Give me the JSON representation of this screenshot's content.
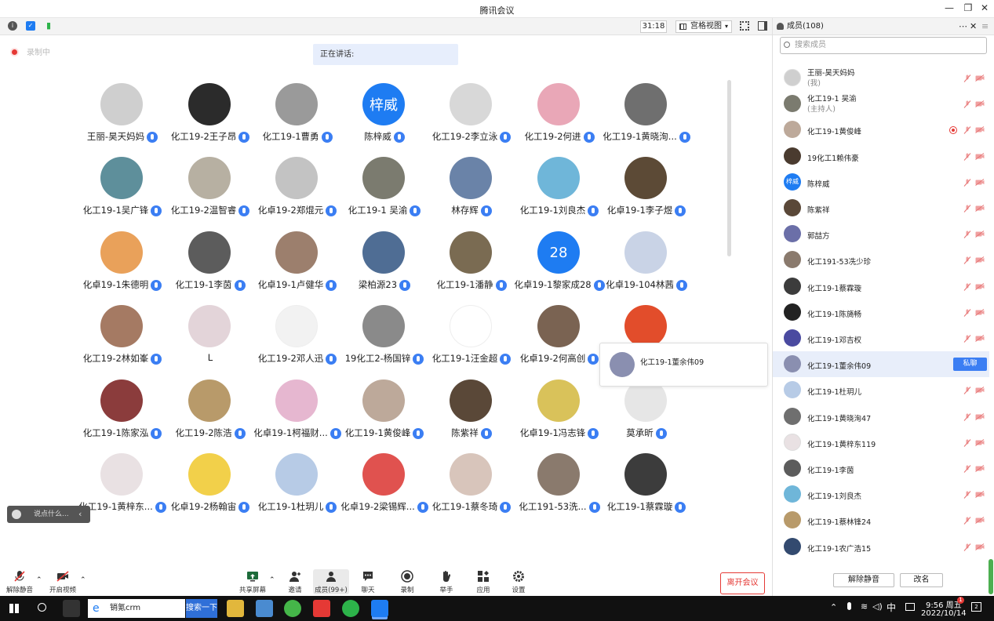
{
  "window": {
    "title": "腾讯会议"
  },
  "toolbar": {
    "timer": "31:18",
    "view_mode": "宫格视图"
  },
  "recording": {
    "label": "录制中"
  },
  "speaking": {
    "label": "正在讲话:"
  },
  "grid": [
    {
      "name": "王丽-昊天妈妈",
      "color": "#cfcfcf",
      "text": ""
    },
    {
      "name": "化工19-2王子昂",
      "color": "#2b2b2b",
      "text": ""
    },
    {
      "name": "化工19-1曹勇",
      "color": "#9a9a9a",
      "text": ""
    },
    {
      "name": "陈梓威",
      "color": "#1e7cf2",
      "text": "梓威"
    },
    {
      "name": "化工19-2李立泳",
      "color": "#d8d8d8",
      "text": ""
    },
    {
      "name": "化工19-2何进",
      "color": "#e9a7b7",
      "text": ""
    },
    {
      "name": "化工19-1黄晓洵...",
      "color": "#6f6f6f",
      "text": ""
    },
    {
      "name": "化工19-1吴广锋",
      "color": "#5e8f9b",
      "text": ""
    },
    {
      "name": "化工19-2温智睿",
      "color": "#b7b0a2",
      "text": ""
    },
    {
      "name": "化卓19-2郑焜元",
      "color": "#c3c3c3",
      "text": ""
    },
    {
      "name": "化工19-1 吴渝",
      "color": "#7b7b6f",
      "text": ""
    },
    {
      "name": "林存辉",
      "color": "#6a83a8",
      "text": ""
    },
    {
      "name": "化工19-1刘良杰",
      "color": "#6fb6d9",
      "text": ""
    },
    {
      "name": "化卓19-1李子煜",
      "color": "#5c4a36",
      "text": ""
    },
    {
      "name": "化卓19-1朱德明",
      "color": "#e9a15a",
      "text": ""
    },
    {
      "name": "化工19-1李茵",
      "color": "#5c5c5c",
      "text": ""
    },
    {
      "name": "化卓19-1卢健华",
      "color": "#9c7f6d",
      "text": ""
    },
    {
      "name": "梁柏源23",
      "color": "#4f6d94",
      "text": ""
    },
    {
      "name": "化工19-1潘静",
      "color": "#7a6b52",
      "text": ""
    },
    {
      "name": "化卓19-1黎家成28",
      "color": "#1e7cf2",
      "text": "28"
    },
    {
      "name": "化卓19-104林茜",
      "color": "#c9d3e6",
      "text": ""
    },
    {
      "name": "化工19-2林如峯",
      "color": "#a57a63",
      "text": ""
    },
    {
      "name": "L",
      "color": "#e3d4d9",
      "text": ""
    },
    {
      "name": "化工19-2邓人迅",
      "color": "#f2f2f2",
      "text": ""
    },
    {
      "name": "19化工2-杨国锌",
      "color": "#8a8a8a",
      "text": ""
    },
    {
      "name": "化工19-1汪金超",
      "color": "#ffffff",
      "text": ""
    },
    {
      "name": "化卓19-2何高创",
      "color": "#7a6352",
      "text": ""
    },
    {
      "name": "",
      "color": "#e24d2b",
      "text": ""
    },
    {
      "name": "化工19-1陈家泓",
      "color": "#8b3c3c",
      "text": ""
    },
    {
      "name": "化工19-2陈浩",
      "color": "#b89a6a",
      "text": ""
    },
    {
      "name": "化卓19-1柯福财...",
      "color": "#e6b7d0",
      "text": ""
    },
    {
      "name": "化工19-1黄俊峰",
      "color": "#bda99a",
      "text": ""
    },
    {
      "name": "陈紫祥",
      "color": "#5a4838",
      "text": ""
    },
    {
      "name": "化卓19-1冯志锋",
      "color": "#d9c25a",
      "text": ""
    },
    {
      "name": "莫承昕",
      "color": "#e6e6e6",
      "text": ""
    },
    {
      "name": "化工19-1黄梓东...",
      "color": "#e9e1e3",
      "text": ""
    },
    {
      "name": "化卓19-2杨翰宙",
      "color": "#f2d04a",
      "text": ""
    },
    {
      "name": "化工19-1杜玥儿",
      "color": "#b7cbe6",
      "text": ""
    },
    {
      "name": "化卓19-2梁锡辉...",
      "color": "#e0524f",
      "text": ""
    },
    {
      "name": "化工19-1蔡冬琦",
      "color": "#d8c5bb",
      "text": ""
    },
    {
      "name": "化工191-53洗...",
      "color": "#8a7a6d",
      "text": ""
    },
    {
      "name": "化工19-1蔡霖璇",
      "color": "#3c3c3c",
      "text": ""
    }
  ],
  "popup": {
    "name": "化工19-1董余伟09"
  },
  "chat": {
    "placeholder": "说点什么..."
  },
  "bottom": {
    "unmute": "解除静音",
    "video": "开启视频",
    "share": "共享屏幕",
    "invite": "邀请",
    "members": "成员(99+)",
    "chat": "聊天",
    "record": "录制",
    "raise": "举手",
    "apps": "应用",
    "settings": "设置",
    "leave": "离开会议"
  },
  "side": {
    "title": "成员(108)",
    "search_placeholder": "搜索成员",
    "private_chat": "私聊",
    "unmute_all": "解除静音",
    "rename": "改名",
    "members": [
      {
        "name": "王丽-昊天妈妈",
        "sub": "(我)",
        "color": "#cfcfcf",
        "text": ""
      },
      {
        "name": "化工19-1 吴渝",
        "sub": "(主持人)",
        "color": "#7b7b6f",
        "text": ""
      },
      {
        "name": "化工19-1黄俊峰",
        "sub": "",
        "color": "#bda99a",
        "text": ""
      },
      {
        "name": "19化工1赖伟豪",
        "sub": "",
        "color": "#4a3b2f",
        "text": ""
      },
      {
        "name": "陈梓威",
        "sub": "",
        "color": "#1e7cf2",
        "text": "梓威"
      },
      {
        "name": "陈紫祥",
        "sub": "",
        "color": "#5a4838",
        "text": ""
      },
      {
        "name": "郭喆方",
        "sub": "",
        "color": "#6b6fa8",
        "text": ""
      },
      {
        "name": "化工191-53冼少珍",
        "sub": "",
        "color": "#8a7a6d",
        "text": ""
      },
      {
        "name": "化工19-1蔡霖璇",
        "sub": "",
        "color": "#3c3c3c",
        "text": ""
      },
      {
        "name": "化工19-1陈旖畅",
        "sub": "",
        "color": "#222222",
        "text": ""
      },
      {
        "name": "化工19-1邓吉权",
        "sub": "",
        "color": "#4a4aa0",
        "text": ""
      },
      {
        "name": "化工19-1董余伟09",
        "sub": "",
        "color": "#8a8fb0",
        "text": ""
      },
      {
        "name": "化工19-1杜玥儿",
        "sub": "",
        "color": "#b7cbe6",
        "text": ""
      },
      {
        "name": "化工19-1黄晓洵47",
        "sub": "",
        "color": "#6f6f6f",
        "text": ""
      },
      {
        "name": "化工19-1黄梓东119",
        "sub": "",
        "color": "#e9e1e3",
        "text": ""
      },
      {
        "name": "化工19-1李茵",
        "sub": "",
        "color": "#5c5c5c",
        "text": ""
      },
      {
        "name": "化工19-1刘良杰",
        "sub": "",
        "color": "#6fb6d9",
        "text": ""
      },
      {
        "name": "化工19-1蔡林锋24",
        "sub": "",
        "color": "#b89a6a",
        "text": ""
      },
      {
        "name": "化工19-1农广浩15",
        "sub": "",
        "color": "#334a6f",
        "text": ""
      }
    ]
  },
  "taskbar": {
    "browser_tab": "销氪crm",
    "search_btn": "搜索一下",
    "ime": "中",
    "time": "9:56 周五",
    "date": "2022/10/14",
    "badge": "1",
    "notif": "2"
  }
}
